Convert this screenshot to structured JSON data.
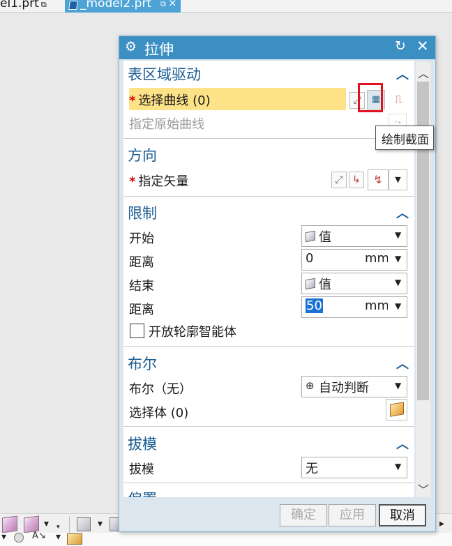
{
  "tabs": [
    {
      "label": "el1.prt",
      "active": false
    },
    {
      "label": "_model2.prt",
      "active": true
    }
  ],
  "dialog": {
    "title": "拉伸",
    "sections": {
      "section_drive": {
        "title": "表区域驱动",
        "select_curve": "选择曲线 (0)",
        "specify_origin": "指定原始曲线"
      },
      "direction": {
        "title": "方向",
        "specify_vector": "指定矢量"
      },
      "limits": {
        "title": "限制",
        "start_label": "开始",
        "start_value": "值",
        "distance1_label": "距离",
        "distance1_value": "0",
        "distance1_unit": "mm",
        "end_label": "结束",
        "end_value": "值",
        "distance2_label": "距离",
        "distance2_value": "50",
        "distance2_unit": "mm",
        "open_profile": "开放轮廓智能体",
        "open_profile_checked": false
      },
      "boolean": {
        "title": "布尔",
        "boolean_label": "布尔（无）",
        "boolean_value": "自动判断",
        "select_body": "选择体 (0)"
      },
      "draft": {
        "title": "拔模",
        "draft_label": "拔模",
        "draft_value": "无"
      },
      "offset": {
        "title": "偏置"
      }
    },
    "buttons": {
      "ok": "确定",
      "apply": "应用",
      "cancel": "取消"
    }
  },
  "tooltip": "绘制截面",
  "colors": {
    "title_bar": "#3b8fc2",
    "section_heading": "#1a5c93",
    "selection_highlight": "#fde287",
    "required_marker": "#d40000",
    "callout_box": "#e2131f",
    "active_tab": "#4da3d6"
  }
}
